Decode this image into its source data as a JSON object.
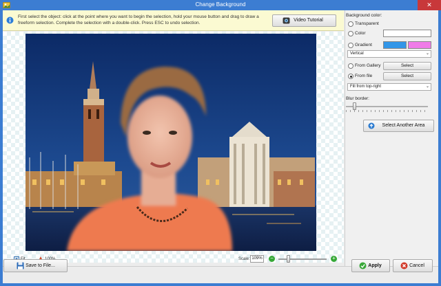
{
  "window": {
    "title": "Change Background",
    "close_glyph": "✕"
  },
  "info": {
    "text": "First select the object: click at the point where you want to begin the selection, hold your mouse button and drag to draw a freeform selection. Complete the selection with a double-click. Press ESC to undo selection.",
    "video_button": "Video Tutorial"
  },
  "background_panel": {
    "heading": "Background color:",
    "transparent": "Transparent",
    "color": "Color",
    "color_swatch": "#ffffff",
    "gradient": "Gradient",
    "gradient_color1": "#3296e8",
    "gradient_color2": "#f07ce8",
    "gradient_direction": "Vertical",
    "from_gallery": "From Gallery",
    "from_file": "From file",
    "select_label": "Select",
    "fill_mode": "Fill from top-right",
    "selected_option": "From file",
    "blur_heading": "Blur border:",
    "select_area_button": "Select Another Area"
  },
  "statusbar": {
    "fit": "Fit",
    "zoom_100": "100%",
    "scale_label": "Scale:",
    "scale_value": "109%",
    "minus": "−",
    "plus": "+"
  },
  "footer": {
    "save_button": "Save to File...",
    "apply_button": "Apply",
    "cancel_button": "Cancel"
  },
  "icons": [
    "app-icon",
    "info-icon",
    "video-icon",
    "fit-icon",
    "zoom-icon",
    "zoom-minus-icon",
    "zoom-plus-icon",
    "select-area-icon",
    "save-icon",
    "apply-icon",
    "cancel-icon"
  ]
}
